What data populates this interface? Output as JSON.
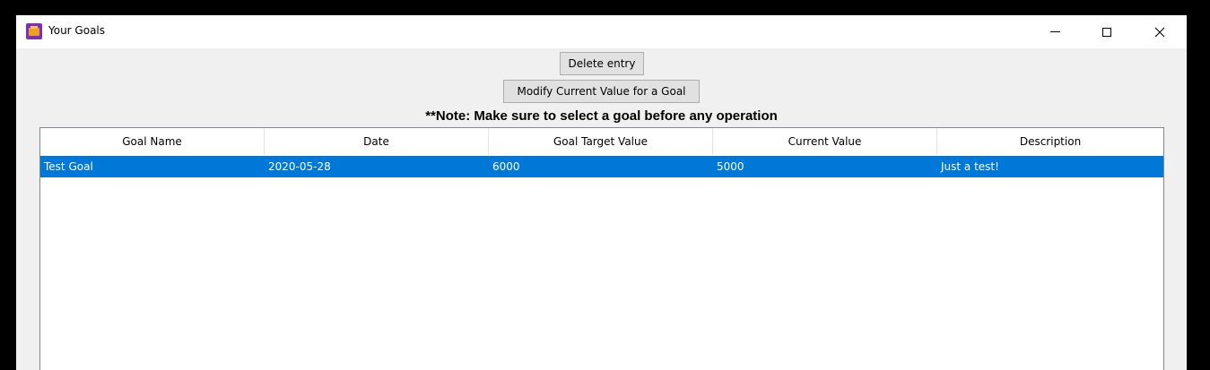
{
  "window": {
    "title": "Your Goals",
    "icon": "app-window-icon"
  },
  "toolbar": {
    "delete_label": "Delete entry",
    "modify_label": "Modify Current Value for a Goal"
  },
  "note": "**Note: Make sure to select a goal before any operation",
  "table": {
    "columns": [
      "Goal Name",
      "Date",
      "Goal Target Value",
      "Current Value",
      "Description"
    ],
    "rows": [
      {
        "cells": [
          "Test Goal",
          "2020-05-28",
          "6000",
          "5000",
          "Just a test!"
        ],
        "selected": true
      }
    ]
  },
  "colors": {
    "selection": "#0078d7",
    "window_bg": "#f0f0f0",
    "button_bg": "#e1e1e1"
  }
}
